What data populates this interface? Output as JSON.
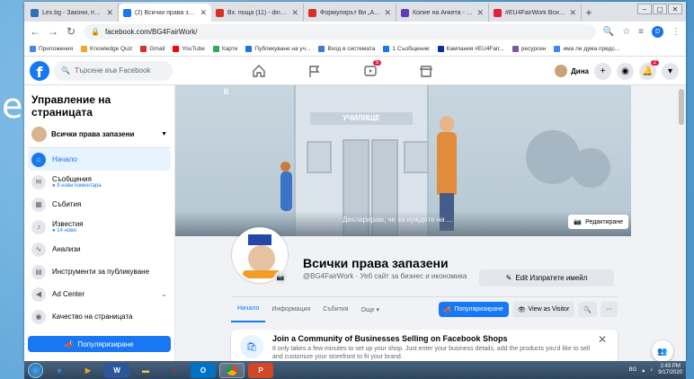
{
  "browser": {
    "tabs": [
      {
        "title": "Lex.bg - Закони, правил",
        "color": "#2e6fb8",
        "active": false
      },
      {
        "title": "(2) Всички права запазе",
        "color": "#1877f2",
        "active": true
      },
      {
        "title": "Вх. поща (11) - dinai72@",
        "color": "#d93025",
        "active": false
      },
      {
        "title": "Формулярът Ви „Анкета“",
        "color": "#d93025",
        "active": false
      },
      {
        "title": "Копие на Анкета - Goo",
        "color": "#673ab7",
        "active": false
      },
      {
        "title": "#EU4FairWork Всички п",
        "color": "#e41e3f",
        "active": false
      }
    ],
    "new_tab": "+",
    "url": "facebook.com/BG4FairWork/",
    "profile_letter": "D",
    "bookmarks": [
      {
        "label": "Приложения",
        "color": "#4285f4"
      },
      {
        "label": "Knowledge Quiz",
        "color": "#f4a62a"
      },
      {
        "label": "Gmail",
        "color": "#d93025"
      },
      {
        "label": "YouTube",
        "color": "#ff0000"
      },
      {
        "label": "Карти",
        "color": "#34a853"
      },
      {
        "label": "Публикуване на уч...",
        "color": "#1a73e8"
      },
      {
        "label": "Вход в системата",
        "color": "#3c7cd6"
      },
      {
        "label": "1 Съобщение",
        "color": "#1877f2"
      },
      {
        "label": "Кампания #EU4Fair...",
        "color": "#0033a0"
      },
      {
        "label": "ресурсен",
        "color": "#7a5a9a"
      },
      {
        "label": "има ли дума предс...",
        "color": "#4285f4"
      }
    ]
  },
  "fb": {
    "search_placeholder": "Търсене във Facebook",
    "nav_badge": "5",
    "user_name": "Дина",
    "notif_badge": "2"
  },
  "sidebar": {
    "title": "Управление на страницата",
    "page_name": "Всички права запазени",
    "items": [
      {
        "label": "Начало",
        "sub": "",
        "icon": "⌂",
        "active": true
      },
      {
        "label": "Съобщения",
        "sub": "● 9 нови коментара",
        "icon": "✉",
        "active": false
      },
      {
        "label": "Събития",
        "sub": "",
        "icon": "▦",
        "active": false
      },
      {
        "label": "Известия",
        "sub": "● 14 нови",
        "icon": "🔔",
        "active": false
      },
      {
        "label": "Анализи",
        "sub": "",
        "icon": "∿",
        "active": false
      },
      {
        "label": "Инструменти за публикуване",
        "sub": "",
        "icon": "▤",
        "active": false
      },
      {
        "label": "Ad Center",
        "sub": "",
        "icon": "📣",
        "active": false
      },
      {
        "label": "Качество на страницата",
        "sub": "",
        "icon": "◉",
        "active": false
      }
    ],
    "promote": "Популяризиране"
  },
  "cover": {
    "school_sign": "УЧИЛИЩЕ",
    "caption": "Декларирам, че за нуждите на ...",
    "edit_label": "Редактиране"
  },
  "page": {
    "name": "Всички права запазени",
    "handle": "@BG4FairWork · Уеб сайт за бизнес и икономика",
    "edit_email": "Edit Изпратете имейл",
    "tabs": [
      "Начало",
      "Информация",
      "Събития",
      "Още ▾"
    ],
    "promote": "Популяризиране",
    "view_as_visitor": "View as Visitor",
    "more": "···"
  },
  "shops_card": {
    "title": "Join a Community of Businesses Selling on Facebook Shops",
    "desc": "It only takes a few minutes to set up your shop. Just enter your business details, add the products you'd like to sell and customize your storefront to fit your brand."
  },
  "taskbar": {
    "lang": "BG",
    "time": "2:43 PM",
    "date": "9/17/2020"
  }
}
